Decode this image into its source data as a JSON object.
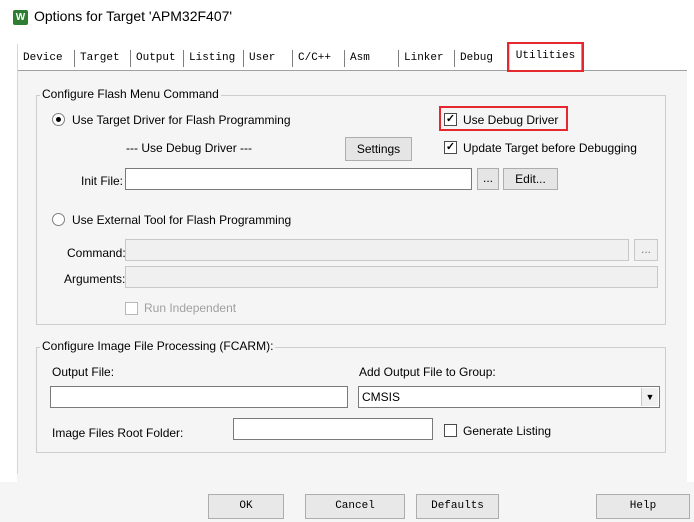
{
  "window": {
    "icon": "uvision-icon",
    "title": "Options for Target 'APM32F407'"
  },
  "tabs": [
    {
      "label": "Device"
    },
    {
      "label": "Target"
    },
    {
      "label": "Output"
    },
    {
      "label": "Listing"
    },
    {
      "label": "User"
    },
    {
      "label": "C/C++"
    },
    {
      "label": "Asm"
    },
    {
      "label": "Linker"
    },
    {
      "label": "Debug"
    },
    {
      "label": "Utilities",
      "active": true
    }
  ],
  "flash": {
    "group_label": "Configure Flash Menu Command",
    "use_target_driver_label": "Use Target Driver for Flash Programming",
    "use_target_driver_selected": true,
    "use_debug_driver_label": "Use Debug Driver",
    "use_debug_driver_checked": true,
    "driver_display": "--- Use Debug Driver ---",
    "settings_label": "Settings",
    "update_target_label": "Update Target before Debugging",
    "update_target_checked": true,
    "init_file_label": "Init File:",
    "init_file_value": "",
    "browse_label": "...",
    "edit_label": "Edit...",
    "use_external_tool_label": "Use External Tool for Flash Programming",
    "use_external_tool_selected": false,
    "command_label": "Command:",
    "command_value": "",
    "command_browse_label": "...",
    "arguments_label": "Arguments:",
    "arguments_value": "",
    "run_independent_label": "Run Independent",
    "run_independent_checked": false
  },
  "image": {
    "group_label": "Configure Image File Processing (FCARM):",
    "output_file_label": "Output File:",
    "output_file_value": "",
    "add_output_label": "Add Output File  to Group:",
    "group_value": "CMSIS",
    "root_folder_label": "Image Files Root Folder:",
    "root_folder_value": "",
    "generate_listing_label": "Generate Listing",
    "generate_listing_checked": false
  },
  "footer": {
    "ok_label": "OK",
    "cancel_label": "Cancel",
    "defaults_label": "Defaults",
    "help_label": "Help"
  },
  "colors": {
    "highlight": "#e5282d",
    "dialog_bg": "#f5f5f5"
  }
}
